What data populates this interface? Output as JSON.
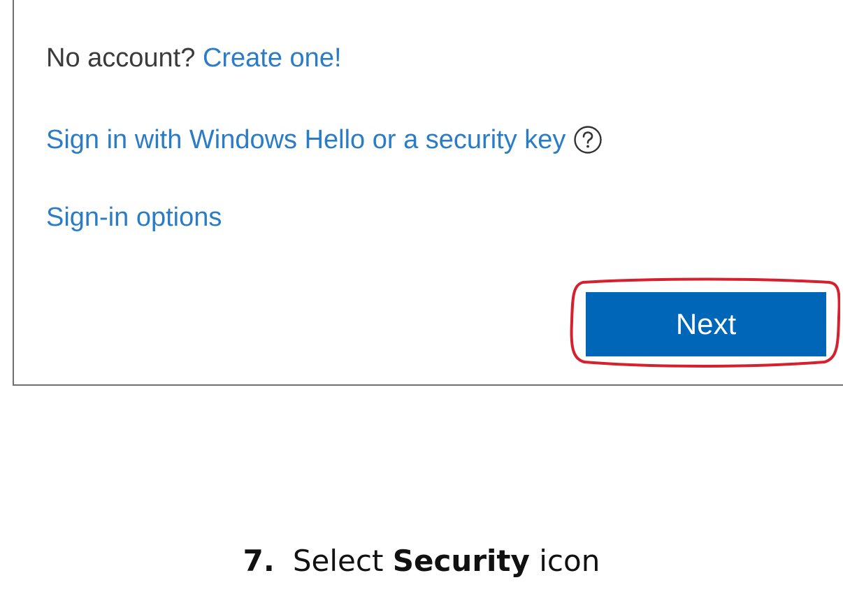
{
  "dialog": {
    "no_account_text": "No account?",
    "create_link": "Create one!",
    "windows_hello_link": "Sign in with Windows Hello or a security key",
    "help_icon": "question-circle-icon",
    "sign_in_options_link": "Sign-in options",
    "next_button": "Next"
  },
  "caption": {
    "step_number": "7.",
    "prefix": "Select",
    "bold_word": "Security",
    "suffix": "icon"
  },
  "colors": {
    "link": "#2b7cc7",
    "primary_button": "#0067b8",
    "annotation_red": "#d6202e"
  }
}
